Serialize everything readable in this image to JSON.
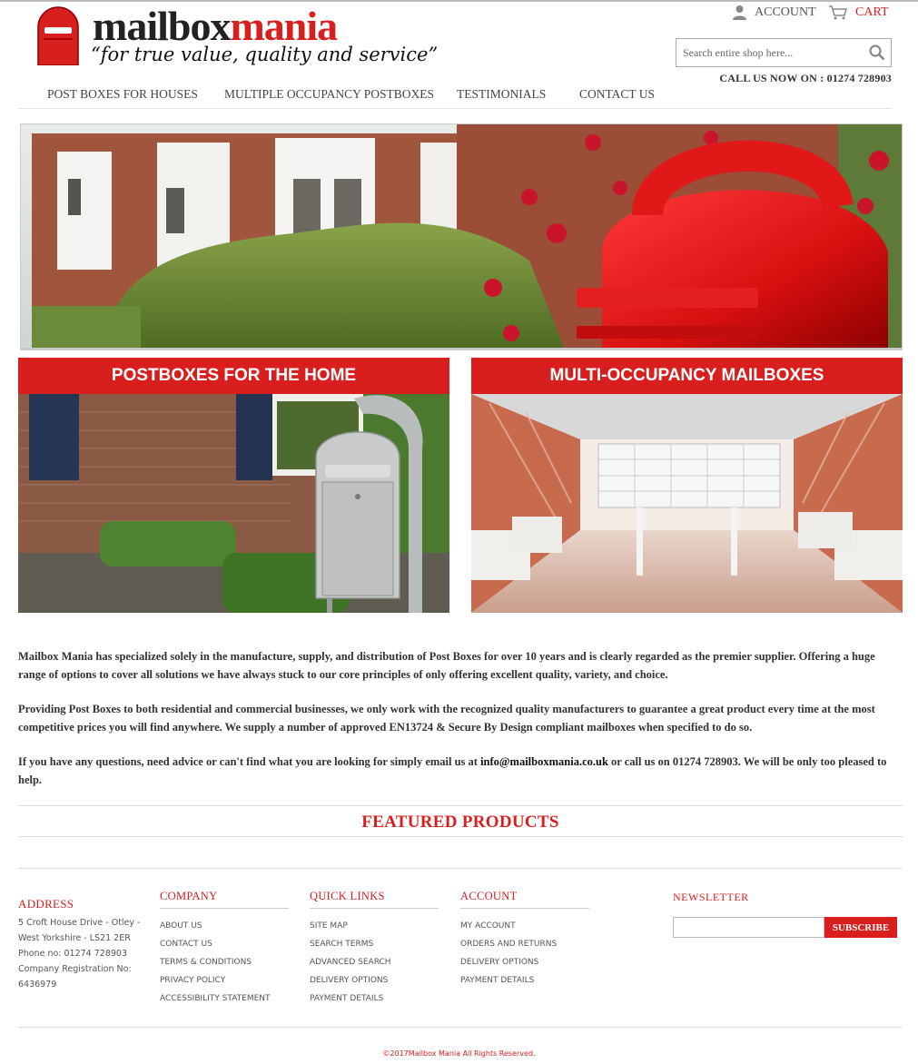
{
  "brand": {
    "name_part1": "mailbox",
    "name_part2": "mania",
    "tagline": "“for true value, quality and service”",
    "accent_color": "#d91e1e"
  },
  "header": {
    "account_label": "ACCOUNT",
    "cart_label": "CART",
    "search_placeholder": "Search entire shop here...",
    "call_us": "CALL US NOW ON : 01274 728903"
  },
  "nav": {
    "items": [
      "POST BOXES FOR HOUSES",
      "MULTIPLE OCCUPANCY POSTBOXES",
      "TESTIMONIALS",
      "CONTACT US"
    ]
  },
  "categories": [
    {
      "title": "POSTBOXES FOR THE HOME"
    },
    {
      "title": "MULTI-OCCUPANCY MAILBOXES"
    }
  ],
  "intro": {
    "p1": "Mailbox Mania has specialized solely in the manufacture, supply, and distribution of Post Boxes for over 10 years and is clearly regarded as the premier supplier. Offering a huge range of options to cover all solutions we have always stuck to our core principles of only offering excellent quality, variety, and choice.",
    "p2": "Providing Post Boxes to both residential and commercial businesses, we only work with the recognized quality manufacturers to guarantee a great product every time at the most competitive prices you will find anywhere. We supply a number of approved EN13724 & Secure By Design compliant mailboxes when specified to do so.",
    "p3_before": "If you have any questions, need advice or can't find what you are looking for simply email us at ",
    "email": "info@mailboxmania.co.uk",
    "p3_after": " or call us on 01274 728903. We will be only too pleased to help."
  },
  "featured_title": "FEATURED PRODUCTS",
  "footer": {
    "address_title": "ADDRESS",
    "address_lines": [
      "5 Croft House Drive - Otley - West Yorkshire - LS21 2ER",
      "Phone no: 01274 728903",
      "Company Registration No: 6436979"
    ],
    "company": {
      "title": "COMPANY",
      "links": [
        "ABOUT US",
        "CONTACT US",
        "TERMS & CONDITIONS",
        "PRIVACY POLICY",
        "ACCESSIBILITY STATEMENT"
      ]
    },
    "quick_links": {
      "title": "QUICK LINKS",
      "links": [
        "SITE MAP",
        "SEARCH TERMS",
        "ADVANCED SEARCH",
        "DELIVERY OPTIONS",
        "PAYMENT DETAILS"
      ]
    },
    "account": {
      "title": "ACCOUNT",
      "links": [
        "MY ACCOUNT",
        "ORDERS AND RETURNS",
        "DELIVERY OPTIONS",
        "PAYMENT DETAILS"
      ]
    },
    "newsletter": {
      "title": "NEWSLETTER",
      "button": "SUBSCRIBE",
      "email_value": ""
    },
    "copyright": "©2017Mailbox Mania All Rights Reserved."
  }
}
